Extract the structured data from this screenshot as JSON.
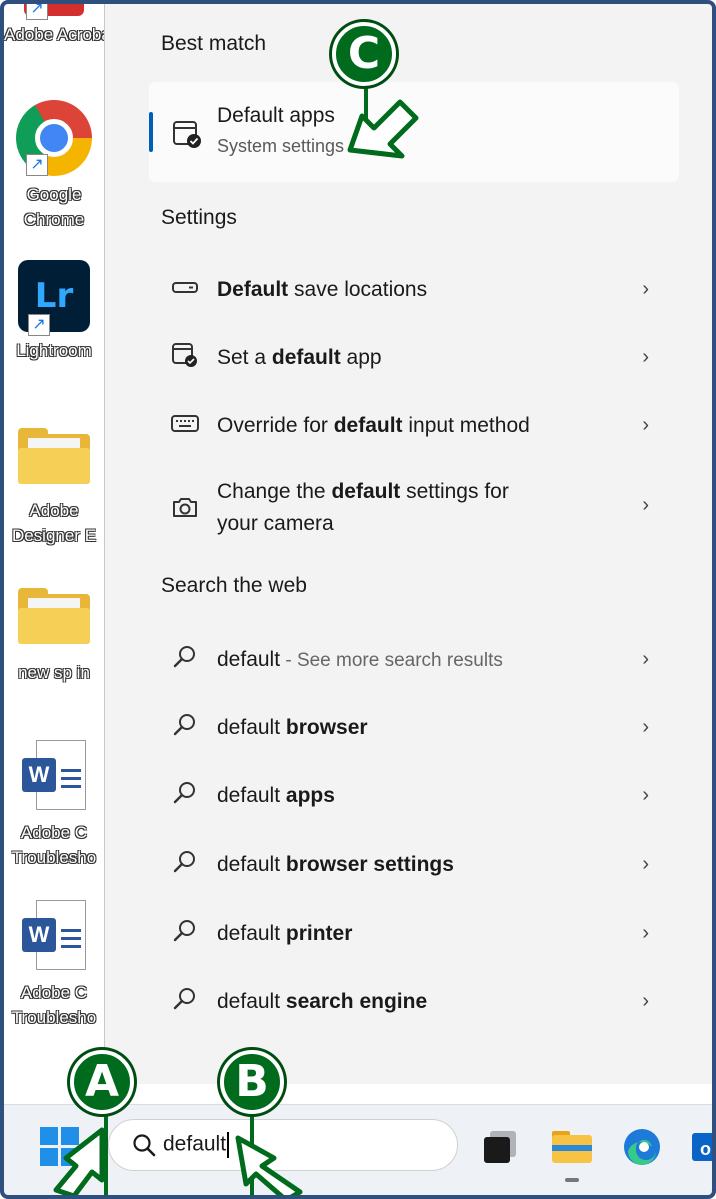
{
  "desktop": {
    "icons": [
      {
        "label": "Adobe Acrobat",
        "icon": "acrobat-icon"
      },
      {
        "label": "Google Chrome",
        "icon": "chrome-icon"
      },
      {
        "label": "Lightroom",
        "icon": "lightroom-icon"
      },
      {
        "label": "Adobe Designer E",
        "icon": "folder-icon"
      },
      {
        "label": "new sp in",
        "icon": "folder-icon"
      },
      {
        "label": "Adobe C Troublesho",
        "icon": "word-doc-icon"
      },
      {
        "label": "Adobe C Troublesho",
        "icon": "word-doc-icon"
      }
    ]
  },
  "search_panel": {
    "best_match_title": "Best match",
    "best_match": {
      "title": "Default apps",
      "subtitle": "System settings",
      "icon": "default-apps-icon"
    },
    "settings_title": "Settings",
    "settings_items": [
      {
        "pre": "",
        "bold": "Default",
        "post": " save locations",
        "post2": "",
        "icon": "drive-icon"
      },
      {
        "pre": "Set a ",
        "bold": "default",
        "post": " app",
        "post2": "",
        "icon": "default-apps-icon"
      },
      {
        "pre": "Override for ",
        "bold": "default",
        "post": " input method",
        "post2": "",
        "icon": "keyboard-icon"
      },
      {
        "pre": "Change the ",
        "bold": "default",
        "post": " settings for",
        "post2": "your camera",
        "icon": "camera-icon"
      }
    ],
    "web_title": "Search the web",
    "web_items": [
      {
        "pre": "default",
        "bold": "",
        "dim": " - See more search results"
      },
      {
        "pre": "default ",
        "bold": "browser",
        "dim": ""
      },
      {
        "pre": "default ",
        "bold": "apps",
        "dim": ""
      },
      {
        "pre": "default ",
        "bold": "browser settings",
        "dim": ""
      },
      {
        "pre": "default ",
        "bold": "printer",
        "dim": ""
      },
      {
        "pre": "default ",
        "bold": "search engine",
        "dim": ""
      }
    ],
    "chevron": "›"
  },
  "taskbar": {
    "search_value": "default",
    "icons": [
      "windows-start-icon",
      "search-icon",
      "task-view-icon",
      "file-explorer-icon",
      "edge-icon",
      "outlook-icon"
    ]
  },
  "callouts": [
    {
      "letter": "A",
      "target": "windows-start-button"
    },
    {
      "letter": "B",
      "target": "search-input"
    },
    {
      "letter": "C",
      "target": "best-match-default-apps"
    }
  ],
  "colors": {
    "callout_green": "#006b1c",
    "accent_blue": "#005fb8",
    "panel_bg": "#f3f3f3"
  }
}
